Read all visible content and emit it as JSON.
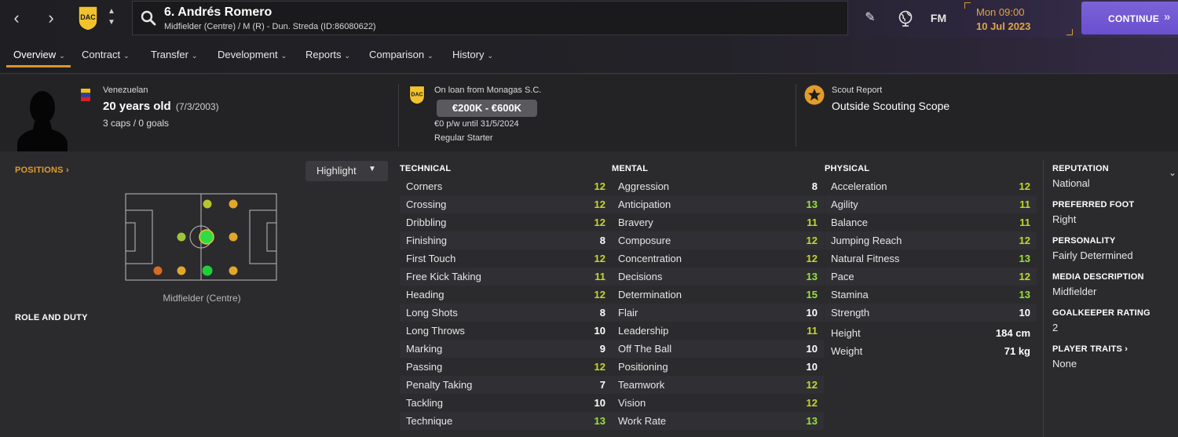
{
  "header": {
    "player_name": "6. Andrés Romero",
    "player_desc": "Midfielder (Centre) / M (R) - Dun. Streda (ID:86080622)",
    "time": "Mon 09:00",
    "date": "10 Jul 2023",
    "fm_label": "FM",
    "continue_label": "CONTINUE",
    "icons": [
      "back-icon",
      "forward-icon",
      "club-crest-icon",
      "search-icon",
      "edit-icon",
      "globe-icon"
    ]
  },
  "tabs": [
    {
      "label": "Overview",
      "active": true
    },
    {
      "label": "Contract"
    },
    {
      "label": "Transfer"
    },
    {
      "label": "Development"
    },
    {
      "label": "Reports"
    },
    {
      "label": "Comparison"
    },
    {
      "label": "History"
    }
  ],
  "profile": {
    "nationality": "Venezuelan",
    "age": "20 years old",
    "dob": "(7/3/2003)",
    "caps": "3 caps / 0 goals"
  },
  "contract": {
    "loan_from": "On loan from Monagas S.C.",
    "value": "€200K - €600K",
    "wage": "€0 p/w until 31/5/2024",
    "status": "Regular Starter"
  },
  "scout": {
    "label": "Scout Report",
    "value": "Outside Scouting Scope"
  },
  "positions": {
    "header": "POSITIONS",
    "highlight_label": "Highlight",
    "position_label": "Midfielder (Centre)",
    "role_header": "ROLE AND DUTY"
  },
  "technical": {
    "header": "TECHNICAL",
    "rows": [
      {
        "name": "Corners",
        "value": "12"
      },
      {
        "name": "Crossing",
        "value": "12"
      },
      {
        "name": "Dribbling",
        "value": "12"
      },
      {
        "name": "Finishing",
        "value": "8"
      },
      {
        "name": "First Touch",
        "value": "12"
      },
      {
        "name": "Free Kick Taking",
        "value": "11"
      },
      {
        "name": "Heading",
        "value": "12"
      },
      {
        "name": "Long Shots",
        "value": "8"
      },
      {
        "name": "Long Throws",
        "value": "10"
      },
      {
        "name": "Marking",
        "value": "9"
      },
      {
        "name": "Passing",
        "value": "12"
      },
      {
        "name": "Penalty Taking",
        "value": "7"
      },
      {
        "name": "Tackling",
        "value": "10"
      },
      {
        "name": "Technique",
        "value": "13"
      }
    ]
  },
  "mental": {
    "header": "MENTAL",
    "rows": [
      {
        "name": "Aggression",
        "value": "8"
      },
      {
        "name": "Anticipation",
        "value": "13"
      },
      {
        "name": "Bravery",
        "value": "11"
      },
      {
        "name": "Composure",
        "value": "12"
      },
      {
        "name": "Concentration",
        "value": "12"
      },
      {
        "name": "Decisions",
        "value": "13"
      },
      {
        "name": "Determination",
        "value": "15"
      },
      {
        "name": "Flair",
        "value": "10"
      },
      {
        "name": "Leadership",
        "value": "11"
      },
      {
        "name": "Off The Ball",
        "value": "10"
      },
      {
        "name": "Positioning",
        "value": "10"
      },
      {
        "name": "Teamwork",
        "value": "12"
      },
      {
        "name": "Vision",
        "value": "12"
      },
      {
        "name": "Work Rate",
        "value": "13"
      }
    ]
  },
  "physical": {
    "header": "PHYSICAL",
    "rows": [
      {
        "name": "Acceleration",
        "value": "12"
      },
      {
        "name": "Agility",
        "value": "11"
      },
      {
        "name": "Balance",
        "value": "11"
      },
      {
        "name": "Jumping Reach",
        "value": "12"
      },
      {
        "name": "Natural Fitness",
        "value": "13"
      },
      {
        "name": "Pace",
        "value": "12"
      },
      {
        "name": "Stamina",
        "value": "13"
      },
      {
        "name": "Strength",
        "value": "10"
      }
    ],
    "height_label": "Height",
    "height_value": "184 cm",
    "weight_label": "Weight",
    "weight_value": "71 kg"
  },
  "sidebar": {
    "reputation_h": "REPUTATION",
    "reputation_v": "National",
    "foot_h": "PREFERRED FOOT",
    "foot_v": "Right",
    "personality_h": "PERSONALITY",
    "personality_v": "Fairly Determined",
    "media_h": "MEDIA DESCRIPTION",
    "media_v": "Midfielder",
    "gk_h": "GOALKEEPER RATING",
    "gk_v": "2",
    "traits_h": "PLAYER TRAITS",
    "traits_v": "None"
  },
  "colors": {
    "accent_orange": "#e39b2b",
    "continue_purple": "#6a4fcf",
    "attr_good": "#c6d62b",
    "attr_very_good": "#9be13a"
  }
}
